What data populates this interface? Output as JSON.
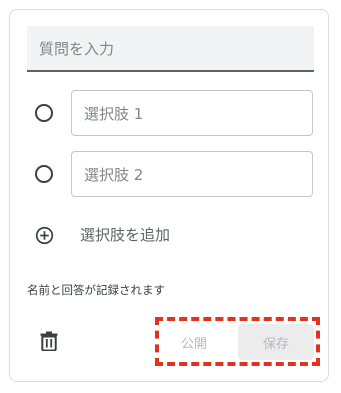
{
  "question": {
    "placeholder": "質問を入力"
  },
  "options": [
    {
      "placeholder": "選択肢 1"
    },
    {
      "placeholder": "選択肢 2"
    }
  ],
  "add_option": {
    "label": "選択肢を追加",
    "icon": "add-circle-icon"
  },
  "record_note": "名前と回答が記録されます",
  "footer": {
    "delete_icon": "trash-icon",
    "publish_label": "公開",
    "save_label": "保存"
  },
  "colors": {
    "highlight_dash": "#e0321e",
    "input_bg": "#f1f3f4",
    "disabled_text": "#b6b9bd"
  }
}
